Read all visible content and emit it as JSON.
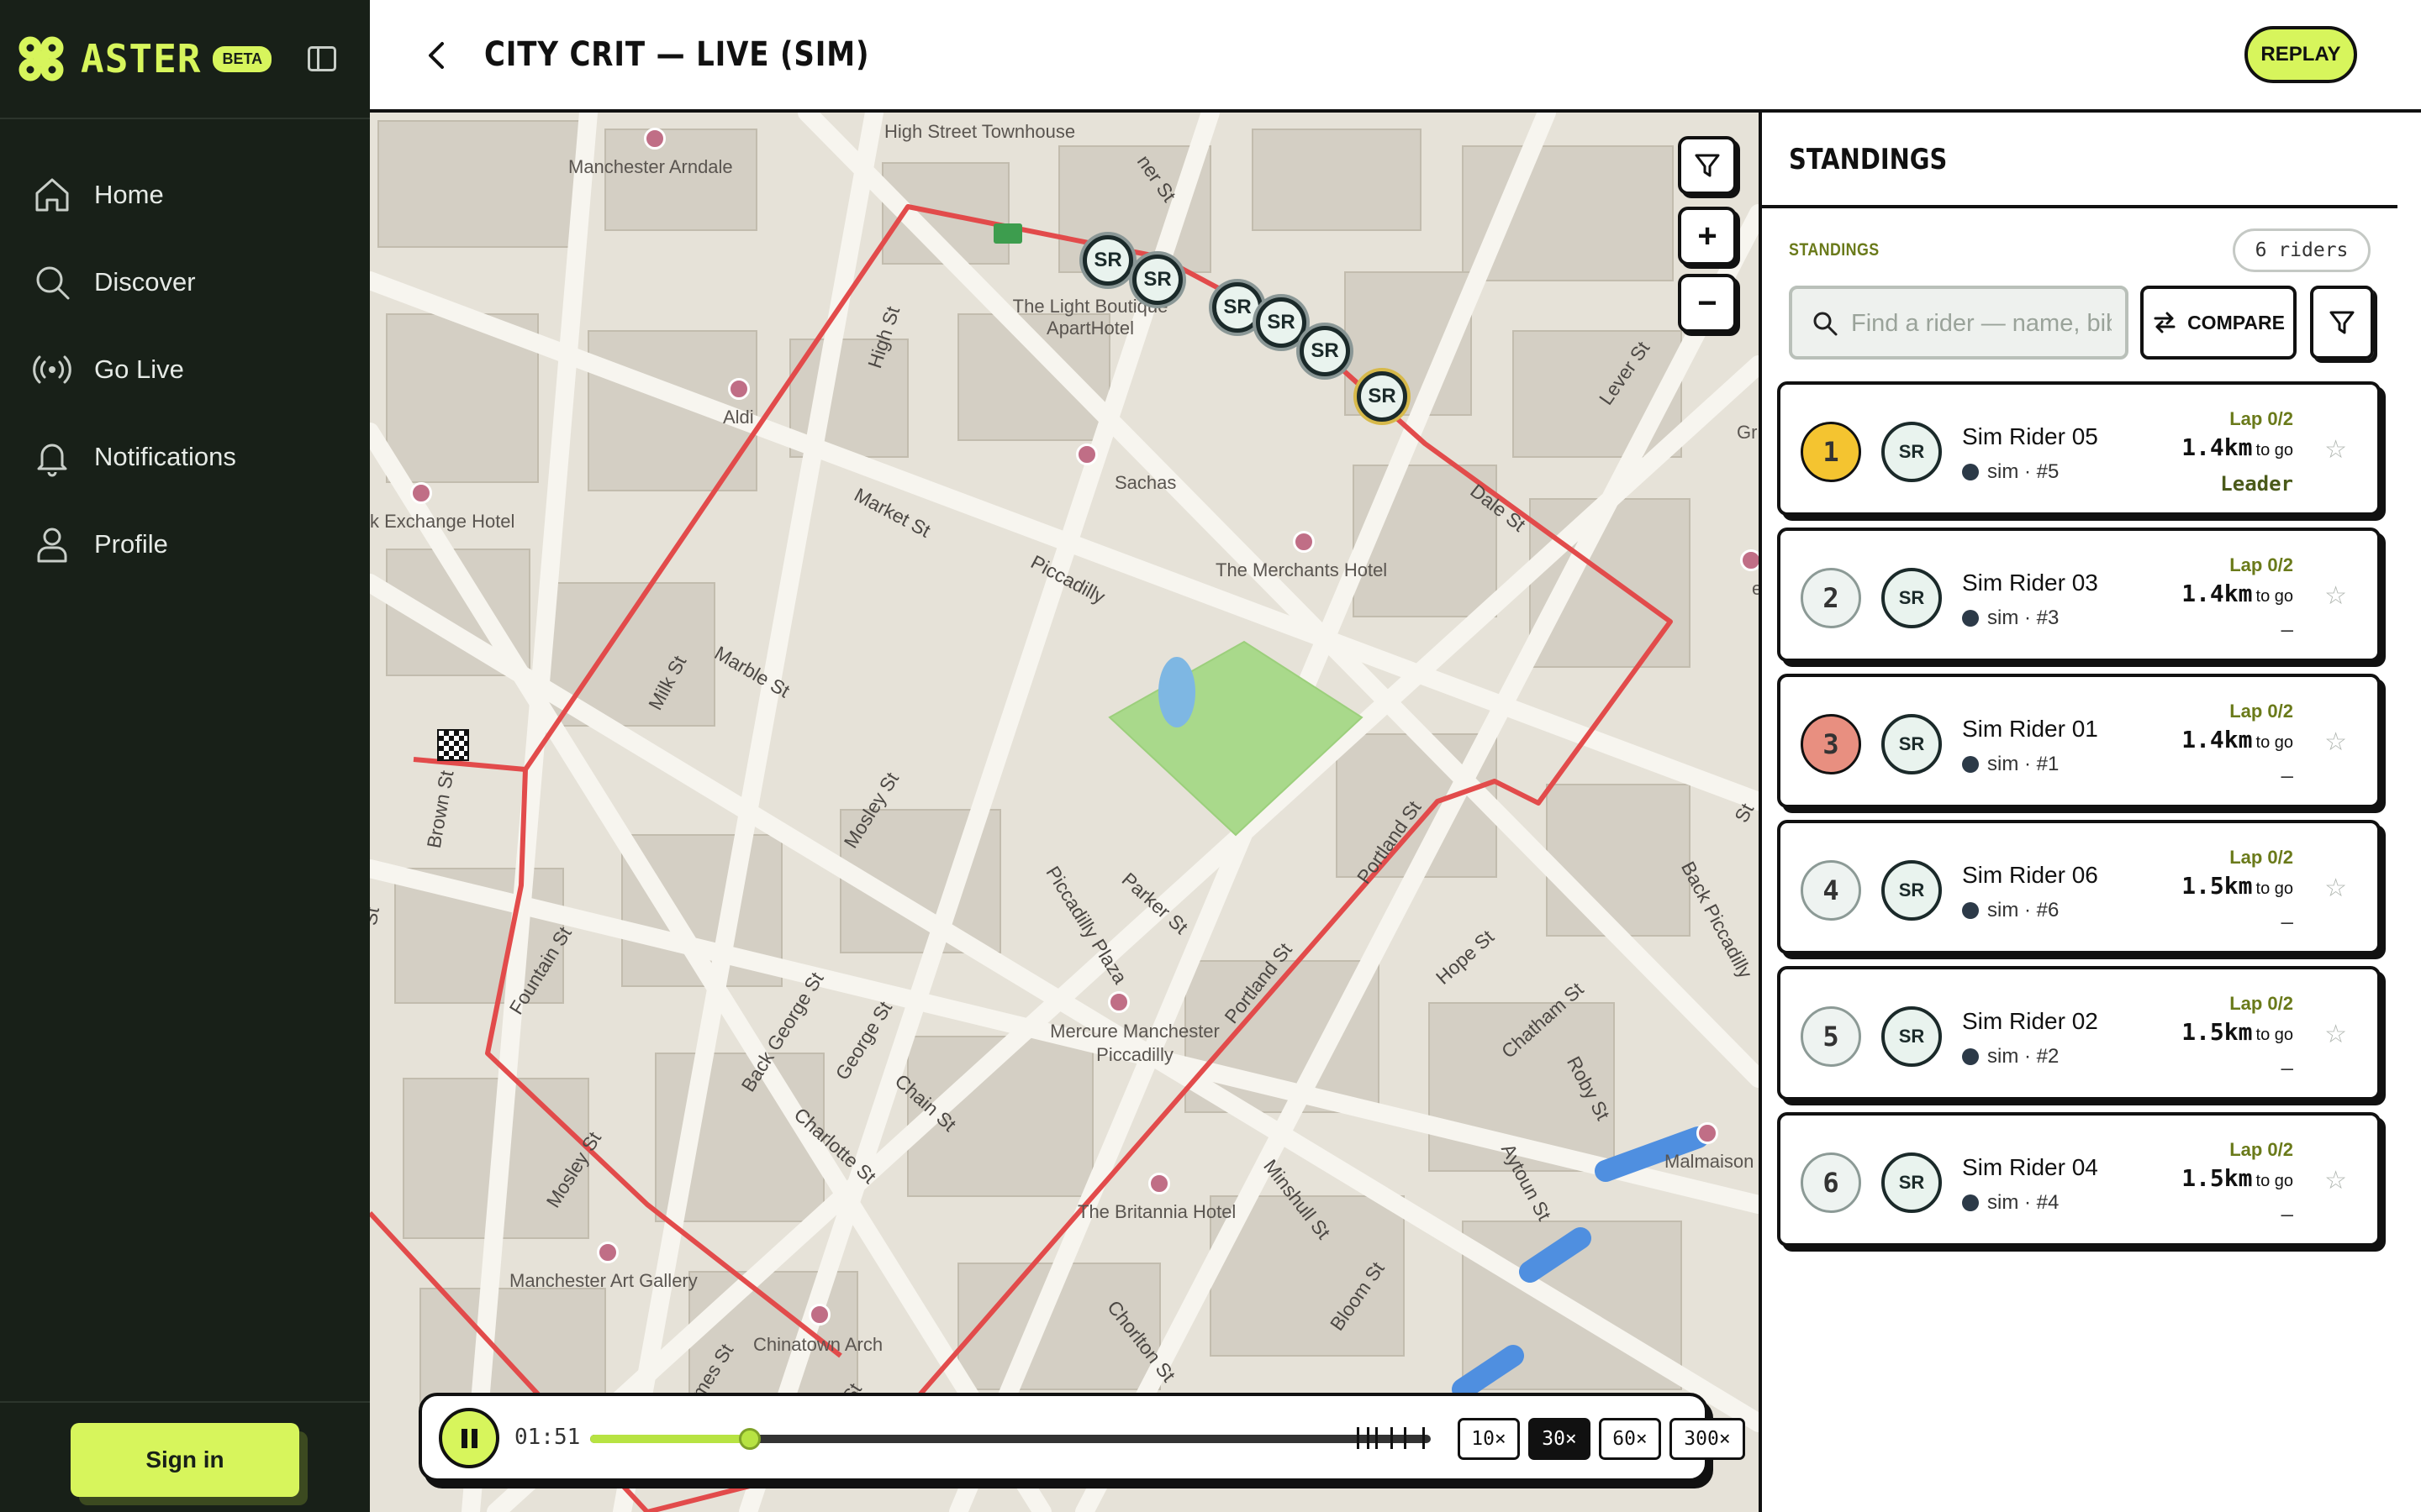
{
  "brand": {
    "name": "ASTER",
    "badge": "BETA"
  },
  "nav": [
    {
      "label": "Home",
      "icon": "home-icon"
    },
    {
      "label": "Discover",
      "icon": "search-icon"
    },
    {
      "label": "Go Live",
      "icon": "broadcast-icon"
    },
    {
      "label": "Notifications",
      "icon": "bell-icon"
    },
    {
      "label": "Profile",
      "icon": "user-icon"
    }
  ],
  "signin_label": "Sign in",
  "header": {
    "title": "CITY CRIT — LIVE (SIM)",
    "replay_label": "REPLAY"
  },
  "map": {
    "places": [
      "Manchester Arndale",
      "High Street Townhouse",
      "The Light Boutique ApartHotel",
      "Aldi",
      "Sachas",
      "k Exchange Hotel",
      "The Merchants Hotel",
      "easyH",
      "Mercure Manchester Piccadilly",
      "The Britannia Hotel",
      "Manchester Art Gallery",
      "Chinatown Arch",
      "Malmaison",
      "Gr"
    ],
    "streets": [
      "High St",
      "Market St",
      "Piccadilly",
      "Marble St",
      "Milk St",
      "Dale St",
      "Lever St",
      "Brown St",
      "Fountain St",
      "Mosley St",
      "Piccadilly Plaza",
      "Parker St",
      "Portland St",
      "Back George St",
      "George St",
      "Chain St",
      "Charlotte St",
      "Hope St",
      "Chatham St",
      "Roby St",
      "Aytoun St",
      "Back Piccadilly",
      "Minshull St",
      "Chorlton St",
      "Bloom St",
      "James St",
      "Mosley St",
      "Portland St",
      "ner St",
      "St",
      "St",
      "St"
    ],
    "riders_on_map": [
      "SR",
      "SR",
      "SR",
      "SR",
      "SR",
      "SR"
    ],
    "filter_icon": "filter-icon",
    "zoom_in": "+",
    "zoom_out": "−"
  },
  "playback": {
    "time": "01:51",
    "progress": 0.19,
    "speeds": [
      "10×",
      "30×",
      "60×",
      "300×"
    ],
    "active_speed": "30×",
    "accent": "#d7f55c"
  },
  "standings": {
    "title": "STANDINGS",
    "section_label": "STANDINGS",
    "count": "6 riders",
    "search_placeholder": "Find a rider — name, bib",
    "compare_label": "COMPARE",
    "riders": [
      {
        "rank": "1",
        "initials": "SR",
        "name": "Sim Rider 05",
        "sub": "sim · #5",
        "lap": "Lap 0/2",
        "dist": "1.4km",
        "to_go": "to go",
        "gap": "Leader",
        "rank_color": "#f4c430"
      },
      {
        "rank": "2",
        "initials": "SR",
        "name": "Sim Rider 03",
        "sub": "sim · #3",
        "lap": "Lap 0/2",
        "dist": "1.4km",
        "to_go": "to go",
        "gap": "—",
        "rank_color": "#eef3f1"
      },
      {
        "rank": "3",
        "initials": "SR",
        "name": "Sim Rider 01",
        "sub": "sim · #1",
        "lap": "Lap 0/2",
        "dist": "1.4km",
        "to_go": "to go",
        "gap": "—",
        "rank_color": "#e88f80"
      },
      {
        "rank": "4",
        "initials": "SR",
        "name": "Sim Rider 06",
        "sub": "sim · #6",
        "lap": "Lap 0/2",
        "dist": "1.5km",
        "to_go": "to go",
        "gap": "—",
        "rank_color": "#eef3f1"
      },
      {
        "rank": "5",
        "initials": "SR",
        "name": "Sim Rider 02",
        "sub": "sim · #2",
        "lap": "Lap 0/2",
        "dist": "1.5km",
        "to_go": "to go",
        "gap": "—",
        "rank_color": "#eef3f1"
      },
      {
        "rank": "6",
        "initials": "SR",
        "name": "Sim Rider 04",
        "sub": "sim · #4",
        "lap": "Lap 0/2",
        "dist": "1.5km",
        "to_go": "to go",
        "gap": "—",
        "rank_color": "#eef3f1"
      }
    ]
  }
}
